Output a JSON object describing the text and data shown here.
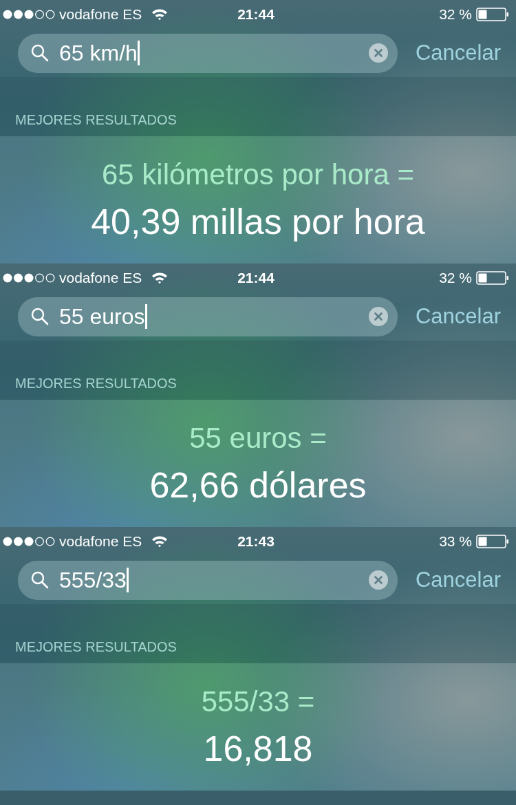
{
  "screens": [
    {
      "status_bar": {
        "carrier": "vodafone ES",
        "time": "21:44",
        "battery": "32 %"
      },
      "search": {
        "value": "65 km/h",
        "cancel": "Cancelar"
      },
      "section_header": "MEJORES RESULTADOS",
      "result": {
        "query": "65 kilómetros por hora =",
        "answer": "40,39 millas por hora"
      }
    },
    {
      "status_bar": {
        "carrier": "vodafone ES",
        "time": "21:44",
        "battery": "32 %"
      },
      "search": {
        "value": "55 euros",
        "cancel": "Cancelar"
      },
      "section_header": "MEJORES RESULTADOS",
      "result": {
        "query": "55 euros =",
        "answer": "62,66 dólares"
      }
    },
    {
      "status_bar": {
        "carrier": "vodafone ES",
        "time": "21:43",
        "battery": "33 %"
      },
      "search": {
        "value": "555/33",
        "cancel": "Cancelar"
      },
      "section_header": "MEJORES RESULTADOS",
      "result": {
        "query": "555/33 =",
        "answer": "16,818"
      }
    }
  ]
}
